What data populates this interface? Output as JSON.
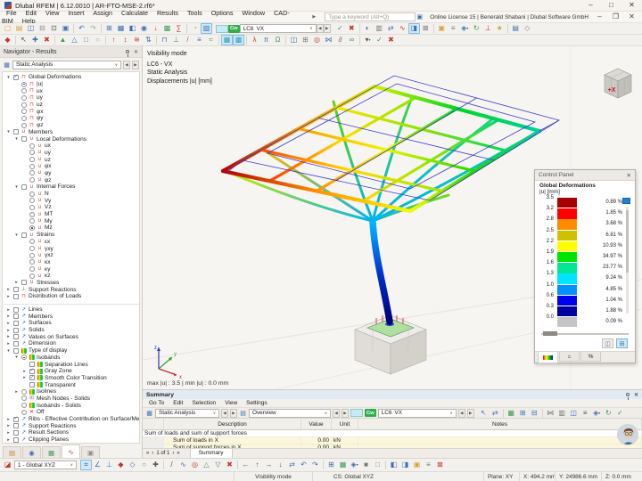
{
  "window": {
    "title": "Dlubal RFEM | 6.12.0010 | AR-FTO-MSE-2.rf6*",
    "controls": [
      [
        "–",
        "#333",
        "minimize"
      ],
      [
        "□",
        "#333",
        "maximize"
      ],
      [
        "✕",
        "#333",
        "close"
      ]
    ]
  },
  "menu": {
    "items": [
      "File",
      "Edit",
      "View",
      "Insert",
      "Assign",
      "Calculate",
      "Results",
      "Tools",
      "Options",
      "Window",
      "CAD-BIM",
      "Help"
    ],
    "search_placeholder": "Type a keyword (Alt+Q)",
    "license": "Online License 15 | Benerald Shabani | Dlubal Software GmbH",
    "controls": [
      [
        "–",
        "#444",
        "minimize-child"
      ],
      [
        "❐",
        "#444",
        "restore-child"
      ],
      [
        "✕",
        "#444",
        "close-child"
      ]
    ]
  },
  "ui": {
    "dropdown": "∨",
    "prev": "◀",
    "next": "▶",
    "pager": [
      "«",
      "‹",
      "›",
      "»"
    ]
  },
  "load_case": {
    "badge": "Cw",
    "case": "LC6",
    "name": "VX"
  },
  "toolbar_top": {
    "left": [
      [
        "▢",
        "#d8a13a",
        "new"
      ],
      [
        "▤",
        "#d8a13a",
        "open"
      ],
      [
        "◫",
        "#3d6fb4",
        "save"
      ],
      [
        "⊟",
        "#888888",
        "close-model"
      ],
      [
        "⊡",
        "#555555",
        "print"
      ],
      [
        "▣",
        "#3d6fb4",
        "settings"
      ],
      [
        "|"
      ],
      [
        "↶",
        "#3d6fb4",
        "undo"
      ],
      [
        "↷",
        "#9aa4b0",
        "redo"
      ],
      [
        "|"
      ],
      [
        "⊞",
        "#3d6fb4",
        "tables"
      ],
      [
        "▦",
        "#3d6fb4",
        "grid"
      ],
      [
        "◧",
        "#3d6fb4",
        "surfaces"
      ],
      [
        "◉",
        "#3d6fb4",
        "nodes"
      ],
      [
        "↓",
        "#c0392b",
        "loads"
      ],
      [
        "▩",
        "#3f9b55",
        "mesh"
      ],
      [
        "∑",
        "#c0392b",
        "calculate"
      ],
      [
        "|"
      ],
      [
        "◔",
        "#d8a13a",
        "results"
      ],
      [
        "▧",
        "#3d6fb4",
        "display",
        "p"
      ]
    ],
    "right": [
      [
        "✓",
        "#3f9b55",
        "apply"
      ],
      [
        "✖",
        "#c0392b",
        "cancel"
      ],
      [
        "|"
      ],
      [
        "◐",
        "#3d6fb4",
        "render-mode"
      ],
      [
        "▥",
        "#777777",
        "wireframe"
      ],
      [
        "⇄",
        "#3d6fb4",
        "compare"
      ],
      [
        "∿",
        "#c0392b",
        "result-diagrams"
      ],
      [
        "◨",
        "#3d6fb4",
        "panel-toggle",
        "p"
      ],
      [
        "⊠",
        "#777777",
        "clipping"
      ],
      [
        "|"
      ],
      [
        "▣",
        "#d8a13a",
        "visibility"
      ],
      [
        "≡",
        "#777777",
        "list-view"
      ],
      [
        "◈",
        "#3d6fb4",
        "saved-views",
        "d"
      ],
      [
        "↻",
        "#3f9b55",
        "refresh"
      ],
      [
        "⊥",
        "#c0392b",
        "supports"
      ],
      [
        "★",
        "#d8a13a",
        "favorites"
      ],
      [
        "|"
      ],
      [
        "▤",
        "#3d6fb4",
        "printout-report"
      ],
      [
        "◇",
        "#888888",
        "misc"
      ]
    ]
  },
  "toolbar_second": {
    "icons": [
      [
        "◆",
        "#c0392b",
        "node-tool"
      ],
      [
        "|"
      ],
      [
        "↖",
        "#444444",
        "select"
      ],
      [
        "✚",
        "#3d6fb4",
        "add-object"
      ],
      [
        "✖",
        "#c0392b",
        "delete-object"
      ],
      [
        "|"
      ],
      [
        "▲",
        "#3f9b55",
        "member-tool"
      ],
      [
        "△",
        "#3d6fb4",
        "surface-tool"
      ],
      [
        "□",
        "#3d6fb4",
        "solid-tool"
      ],
      [
        "○",
        "#9aa4b0",
        "opening-tool"
      ],
      [
        "|"
      ],
      [
        "↑",
        "#c0392b",
        "nodal-load"
      ],
      [
        "↕",
        "#c0392b",
        "line-load"
      ],
      [
        "≋",
        "#c0392b",
        "area-load"
      ],
      [
        "⇅",
        "#3d6fb4",
        "load-combination"
      ],
      [
        "|"
      ],
      [
        "⊓",
        "#3d6fb4",
        "frame-tool"
      ],
      [
        "⊥",
        "#3f9b55",
        "support-tool"
      ],
      [
        "/",
        "#777777",
        "line-tool"
      ],
      [
        "≡",
        "#3d6fb4",
        "layers"
      ],
      [
        "≈",
        "#3f9b55",
        "smooth-results"
      ],
      [
        "|"
      ],
      [
        "▦",
        "#2aa0c0",
        "mesh-display",
        "p"
      ],
      [
        "▩",
        "#2aa0c0",
        "mesh-settings",
        "p"
      ],
      [
        "|"
      ],
      [
        "λ",
        "#c0392b",
        "stability-analysis"
      ],
      [
        "π",
        "#3d6fb4",
        "parameters"
      ],
      [
        "Ω",
        "#3f9b55",
        "dynamic-analysis"
      ],
      [
        "|"
      ],
      [
        "◫",
        "#3d6fb4",
        "window-layout"
      ],
      [
        "⊞",
        "#777777",
        "table-view"
      ],
      [
        "◎",
        "#c0392b",
        "target-snap"
      ],
      [
        "⋈",
        "#3d6fb4",
        "connections"
      ],
      [
        "∂",
        "#777777",
        "partial-view"
      ],
      [
        "∞",
        "#3f9b55",
        "infinite-elements"
      ],
      [
        "|"
      ],
      [
        "▾",
        "#555555",
        "more-tools",
        "d"
      ],
      [
        "✓",
        "#3f9b55",
        "check-model"
      ],
      [
        "✖",
        "#c0392b",
        "stop"
      ]
    ]
  },
  "navigator": {
    "title": "Navigator - Results",
    "combo": "Static Analysis",
    "tree": [
      [
        0,
        1,
        2,
        "gd",
        "Global Deformations"
      ],
      [
        1,
        0,
        4,
        "gd",
        "|u|"
      ],
      [
        1,
        0,
        3,
        "gd",
        "ux"
      ],
      [
        1,
        0,
        3,
        "gd",
        "uy"
      ],
      [
        1,
        0,
        3,
        "gd",
        "uz"
      ],
      [
        1,
        0,
        3,
        "gd",
        "φx"
      ],
      [
        1,
        0,
        3,
        "gd",
        "φy"
      ],
      [
        1,
        0,
        3,
        "gd",
        "φz"
      ],
      [
        0,
        1,
        1,
        "mb",
        "Members"
      ],
      [
        1,
        1,
        1,
        "mb",
        "Local Deformations"
      ],
      [
        2,
        0,
        3,
        "mb",
        "ux"
      ],
      [
        2,
        0,
        3,
        "mb",
        "uy"
      ],
      [
        2,
        0,
        3,
        "mb",
        "uz"
      ],
      [
        2,
        0,
        3,
        "mb",
        "φx"
      ],
      [
        2,
        0,
        3,
        "mb",
        "φy"
      ],
      [
        2,
        0,
        3,
        "mb",
        "φz"
      ],
      [
        1,
        1,
        1,
        "mb",
        "Internal Forces"
      ],
      [
        2,
        0,
        3,
        "mb",
        "N"
      ],
      [
        2,
        0,
        3,
        "mb",
        "Vy"
      ],
      [
        2,
        0,
        3,
        "mb",
        "Vz"
      ],
      [
        2,
        0,
        3,
        "mb",
        "MT"
      ],
      [
        2,
        0,
        3,
        "mb",
        "My"
      ],
      [
        2,
        0,
        4,
        "mb",
        "Mz"
      ],
      [
        1,
        1,
        1,
        "mb",
        "Strains"
      ],
      [
        2,
        0,
        3,
        "mb",
        "εx"
      ],
      [
        2,
        0,
        3,
        "mb",
        "γxy"
      ],
      [
        2,
        0,
        3,
        "mb",
        "γxz"
      ],
      [
        2,
        0,
        3,
        "mb",
        "κx"
      ],
      [
        2,
        0,
        3,
        "mb",
        "κy"
      ],
      [
        2,
        0,
        3,
        "mb",
        "κz"
      ],
      [
        1,
        2,
        1,
        "mb",
        "Stresses"
      ],
      [
        0,
        2,
        1,
        "sr",
        "Support Reactions"
      ],
      [
        0,
        2,
        1,
        "gd",
        "Distribution of Loads"
      ],
      [
        -1,
        0,
        0,
        "",
        "separator"
      ],
      [
        0,
        2,
        1,
        "ln",
        "Lines"
      ],
      [
        0,
        2,
        1,
        "ln",
        "Members"
      ],
      [
        0,
        2,
        1,
        "ln",
        "Surfaces"
      ],
      [
        0,
        2,
        1,
        "ln",
        "Solids"
      ],
      [
        0,
        2,
        1,
        "ln",
        "Values on Surfaces"
      ],
      [
        0,
        2,
        1,
        "ln",
        "Dimension"
      ],
      [
        0,
        1,
        1,
        "td",
        "Type of display"
      ],
      [
        1,
        1,
        4,
        "td",
        "Isobands"
      ],
      [
        2,
        0,
        1,
        "td",
        "Separation Lines"
      ],
      [
        2,
        2,
        2,
        "td",
        "Gray Zone"
      ],
      [
        2,
        2,
        2,
        "td",
        "Smooth Color Transition"
      ],
      [
        2,
        0,
        1,
        "td",
        "Transparent"
      ],
      [
        1,
        2,
        3,
        "td",
        "Isolines"
      ],
      [
        1,
        0,
        3,
        "ms",
        "Mesh Nodes - Solids"
      ],
      [
        1,
        0,
        3,
        "td",
        "Isobands - Solids"
      ],
      [
        1,
        0,
        3,
        "x",
        "Off"
      ],
      [
        0,
        2,
        2,
        "ln",
        "Ribs - Effective Contribution on Surface/Member"
      ],
      [
        0,
        2,
        1,
        "ln",
        "Support Reactions"
      ],
      [
        0,
        2,
        1,
        "ln",
        "Result Sections"
      ],
      [
        0,
        2,
        1,
        "ln",
        "Clipping Planes"
      ]
    ],
    "tabs": [
      [
        "▤",
        "#c08538",
        "data-navigator",
        ""
      ],
      [
        "◉",
        "#3d6fb4",
        "display-navigator",
        ""
      ],
      [
        "▦",
        "#3f9b55",
        "views-navigator",
        ""
      ],
      [
        "∿",
        "#c0392b",
        "results-navigator",
        "active"
      ],
      [
        "▣",
        "#8a8a8a",
        "protocol-navigator",
        ""
      ]
    ]
  },
  "viewport": {
    "overlay": [
      "Visibility mode",
      "LC6 - VX",
      "Static Analysis",
      "Displacements |u| [mm]"
    ],
    "bottom_info": "max |u| : 3.5 | min |u| : 0.0 mm",
    "cube_label": "+X",
    "axes": [
      "x",
      "y",
      "z"
    ]
  },
  "control_panel": {
    "title": "Control Panel",
    "heading": "Global Deformations",
    "unit": "|u| [mm]",
    "ticks": [
      "3.5",
      "3.2",
      "2.8",
      "2.5",
      "2.2",
      "1.9",
      "1.6",
      "1.3",
      "1.0",
      "0.6",
      "0.3",
      "0.0"
    ],
    "bands": [
      {
        "c": "#a80000",
        "p": "0.89 %"
      },
      {
        "c": "#ff0000",
        "p": "1.85 %"
      },
      {
        "c": "#ff8c00",
        "p": "3.68 %"
      },
      {
        "c": "#cdc100",
        "p": "6.81 %"
      },
      {
        "c": "#ffff00",
        "p": "10.93 %"
      },
      {
        "c": "#00e400",
        "p": "34.97 %"
      },
      {
        "c": "#00e896",
        "p": "23.77 %"
      },
      {
        "c": "#00e4ff",
        "p": "9.24 %"
      },
      {
        "c": "#0090ff",
        "p": "4.85 %"
      },
      {
        "c": "#0000f0",
        "p": "1.04 %"
      },
      {
        "c": "#0000a0",
        "p": "1.88 %"
      },
      {
        "c": "#c4c4c4",
        "p": "0.09 %"
      }
    ],
    "buttons": [
      [
        "◫",
        "detach-panel",
        ""
      ],
      [
        "⊞",
        "panel-settings",
        "p"
      ]
    ],
    "tabs": [
      [
        "grad",
        "color-scale-tab",
        "active"
      ],
      [
        "⌂",
        "home-tab",
        ""
      ],
      [
        "%",
        "factors-tab",
        ""
      ]
    ]
  },
  "summary": {
    "title": "Summary",
    "menu": [
      "Go To",
      "Edit",
      "Selection",
      "View",
      "Settings"
    ],
    "combo1": "Static Analysis",
    "combo2": "Overview",
    "icons": [
      [
        "↖",
        "#3d6fb4",
        "select-cells"
      ],
      [
        "⇄",
        "#3d6fb4",
        "sync-selection"
      ],
      [
        "|"
      ],
      [
        "▦",
        "#3f9b55",
        "export-spreadsheet"
      ],
      [
        "⊞",
        "#3d6fb4",
        "insert-table"
      ],
      [
        "⊟",
        "#3d6fb4",
        "remove-table"
      ],
      [
        "|"
      ],
      [
        "⋈",
        "#777777",
        "join-tables"
      ],
      [
        "▥",
        "#777777",
        "column-settings"
      ],
      [
        "◫",
        "#3d6fb4",
        "split-view"
      ],
      [
        "≡",
        "#555555",
        "row-filter"
      ],
      [
        "◈",
        "#3d6fb4",
        "table-filter",
        "d"
      ],
      [
        "↻",
        "#3f9b55",
        "refresh-table"
      ],
      [
        "✓",
        "#3f9b55",
        "validate"
      ]
    ],
    "table": {
      "headers": [
        "",
        "Description",
        "Value",
        "Unit",
        "Notes"
      ],
      "group": "Sum of loads and sum of support forces",
      "rows": [
        [
          "Sum of loads in X",
          "0.00",
          "kN",
          ""
        ],
        [
          "Sum of support forces in X",
          "0.00",
          "kN",
          ""
        ]
      ]
    },
    "pager_text": "1 of 1",
    "tab": "Summary"
  },
  "toolbar_bottom": {
    "combo": "1 - Global XYZ",
    "icons": [
      [
        "⌗",
        "#555555",
        "grid-snap",
        "p"
      ],
      [
        "∠",
        "#3d6fb4",
        "angle-snap"
      ],
      [
        "⊥",
        "#3d6fb4",
        "ortho-snap"
      ],
      [
        "◆",
        "#c0392b",
        "endpoint-snap"
      ],
      [
        "◇",
        "#3d6fb4",
        "midpoint-snap"
      ],
      [
        "○",
        "#3f9b55",
        "center-snap"
      ],
      [
        "✚",
        "#555555",
        "intersection-snap"
      ],
      [
        "|"
      ],
      [
        "/",
        "#555555",
        "draw-line"
      ],
      [
        "∿",
        "#3d6fb4",
        "draw-arc"
      ],
      [
        "◎",
        "#c0392b",
        "draw-circle"
      ],
      [
        "△",
        "#3f9b55",
        "draw-polygon"
      ],
      [
        "▽",
        "#3d6fb4",
        "draw-plane"
      ],
      [
        "✖",
        "#c0392b",
        "trim"
      ],
      [
        "|"
      ],
      [
        "←",
        "#555555",
        "move-left"
      ],
      [
        "↑",
        "#555555",
        "move-up"
      ],
      [
        "→",
        "#555555",
        "move-down"
      ],
      [
        "↓",
        "#555555",
        "move-right"
      ],
      [
        "⇄",
        "#3d6fb4",
        "mirror"
      ],
      [
        "↶",
        "#3d6fb4",
        "rotate-ccw"
      ],
      [
        "↷",
        "#3d6fb4",
        "rotate-cw"
      ],
      [
        "|"
      ],
      [
        "⊞",
        "#3d6fb4",
        "array-copy"
      ],
      [
        "▦",
        "#3f9b55",
        "pattern"
      ],
      [
        "◈",
        "#3d6fb4",
        "block",
        "d"
      ],
      [
        "■",
        "#777777",
        "fill"
      ],
      [
        "□",
        "#777777",
        "outline"
      ],
      [
        "|"
      ],
      [
        "◧",
        "#3d6fb4",
        "half-left"
      ],
      [
        "◨",
        "#3d6fb4",
        "half-right"
      ],
      [
        "▣",
        "#d8a13a",
        "highlight"
      ],
      [
        "≡",
        "#777777",
        "stack"
      ],
      [
        "⊠",
        "#c0392b",
        "close-sketch"
      ]
    ]
  },
  "status_bar": {
    "mode": "Visibility mode",
    "cs": "CS: Global XYZ",
    "plane": "Plane: XY",
    "x": "X: 494.2 mm",
    "y": "Y: 24986.6 mm",
    "z": "Z: 0.0 mm"
  }
}
